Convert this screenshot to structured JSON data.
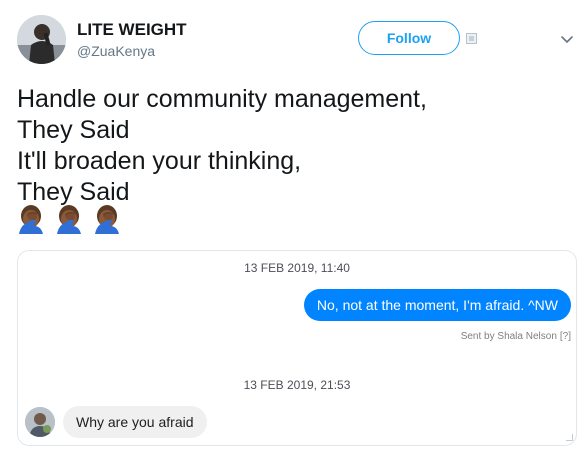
{
  "header": {
    "name": "LITE WEIGHT",
    "handle": "@ZuaKenya",
    "follow_label": "Follow",
    "avatar_icon": "user-avatar-photo",
    "menu_icon": "chevron-down-icon"
  },
  "tweet": {
    "lines": [
      "Handle our community management,",
      "They Said",
      "It'll broaden your thinking,",
      "They Said"
    ],
    "emojis": [
      "facepalm-emoji",
      "facepalm-emoji",
      "facepalm-emoji"
    ]
  },
  "dm": {
    "date_1": "13 FEB 2019, 11:40",
    "outgoing_message": "No, not at the moment, I'm afraid. ^NW",
    "sent_by": "Sent by Shala Nelson",
    "sent_by_help": "[?]",
    "date_2": "13 FEB 2019, 21:53",
    "incoming_message": "Why are you afraid"
  },
  "colors": {
    "accent": "#1da1f2",
    "outgoing_bubble": "#0084ff",
    "incoming_bubble": "#f1f0f0",
    "handle_text": "#657786"
  }
}
